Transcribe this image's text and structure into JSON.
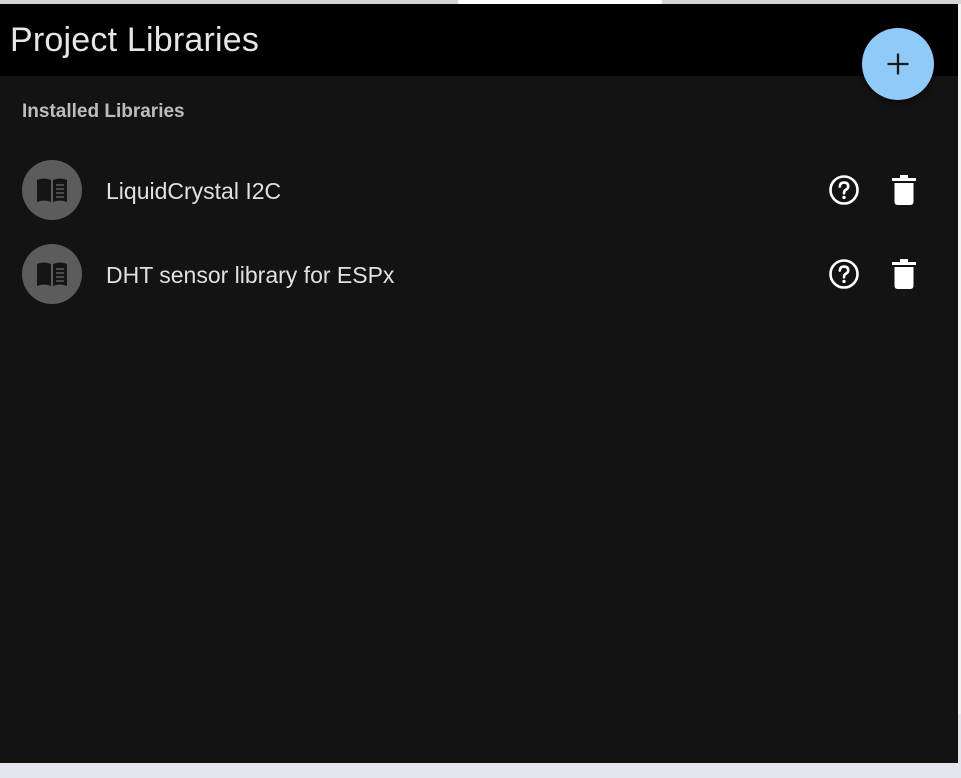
{
  "header": {
    "title": "Project Libraries",
    "add_icon": "plus-icon"
  },
  "main": {
    "section_heading": "Installed Libraries",
    "libraries": [
      {
        "name": "LiquidCrystal I2C",
        "icon": "book-icon"
      },
      {
        "name": "DHT sensor library for ESPx",
        "icon": "book-icon"
      }
    ],
    "row_actions": [
      "help-circle-icon",
      "trash-icon"
    ]
  },
  "colors": {
    "header_bg": "#000000",
    "panel_bg": "#131313",
    "fab_bg": "#90caf9",
    "avatar_bg": "#5c5c5c",
    "text_primary": "#e0e0e0",
    "text_secondary": "#bdbdbd"
  }
}
